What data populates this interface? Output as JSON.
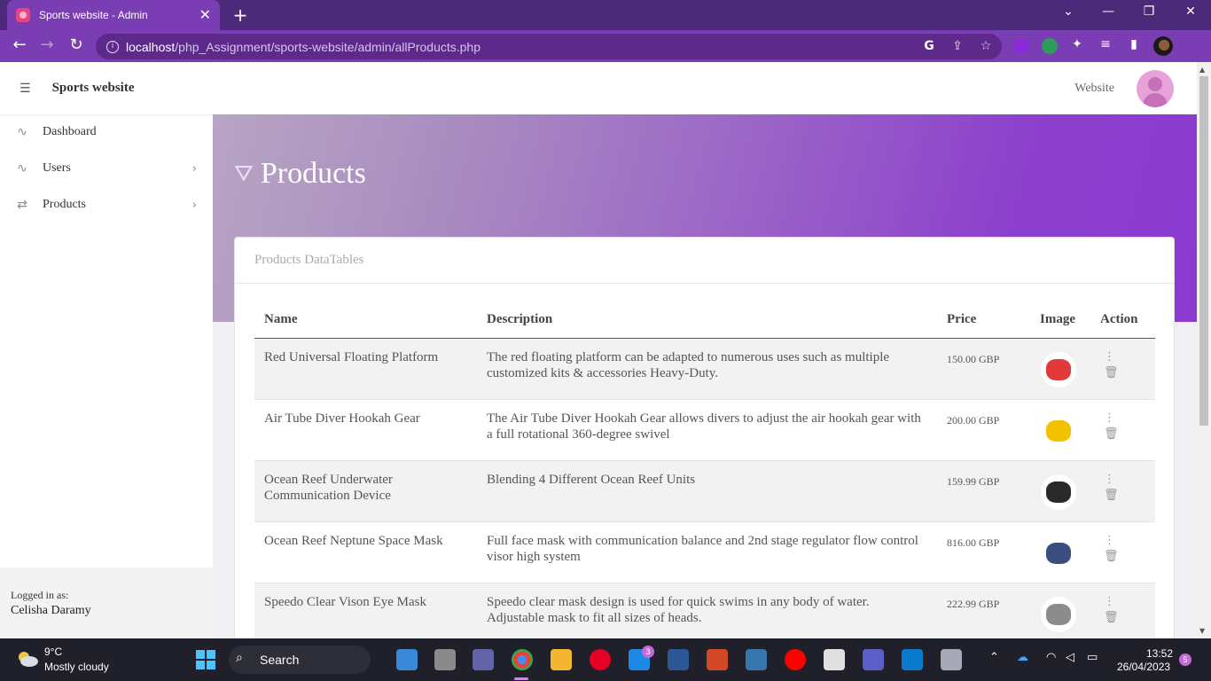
{
  "browser": {
    "tab_title": "Sports website - Admin",
    "url_host": "localhost",
    "url_path": "/php_Assignment/sports-website/admin/allProducts.php",
    "icons": {
      "close": "✕",
      "new_tab": "+",
      "back": "←",
      "forward": "→",
      "reload": "↻",
      "minimize": "—",
      "maximize": "❐",
      "window_close": "✕",
      "chevron": "⌄"
    }
  },
  "sidebar": {
    "brand": "Sports website",
    "items": [
      {
        "label": "Dashboard",
        "icon": "activity-icon"
      },
      {
        "label": "Users",
        "icon": "activity-icon"
      },
      {
        "label": "Products",
        "icon": "repeat-icon"
      }
    ],
    "logged_in_label": "Logged in as:",
    "logged_in_user": "Celisha Daramy"
  },
  "topbar": {
    "website_link": "Website"
  },
  "page": {
    "title": "Products",
    "card_title": "Products DataTables"
  },
  "table": {
    "headers": [
      "Name",
      "Description",
      "Price",
      "Image",
      "Action"
    ],
    "rows": [
      {
        "name": "Red Universal Floating Platform",
        "description": "The red floating platform can be adapted to numerous uses such as multiple customized kits & accessories Heavy-Duty.",
        "price": "150.00 GBP",
        "image_color": "#e23a3a"
      },
      {
        "name": "Air Tube Diver Hookah Gear",
        "description": "The Air Tube Diver Hookah Gear allows divers to adjust the air hookah gear with a full rotational 360-degree swivel",
        "price": "200.00 GBP",
        "image_color": "#f2c200"
      },
      {
        "name": "Ocean Reef Underwater Communication Device",
        "description": "Blending 4 Different Ocean Reef Units",
        "price": "159.99 GBP",
        "image_color": "#2a2a2a"
      },
      {
        "name": "Ocean Reef Neptune Space Mask",
        "description": "Full face mask with communication balance and 2nd stage regulator flow control visor high system",
        "price": "816.00 GBP",
        "image_color": "#3a4f80"
      },
      {
        "name": "Speedo Clear Vison Eye Mask",
        "description": "Speedo clear mask design is used for quick swims in any body of water. Adjustable mask to fit all sizes of heads.",
        "price": "222.99 GBP",
        "image_color": "#8c8c8c"
      }
    ]
  },
  "taskbar": {
    "temperature": "9°C",
    "condition": "Mostly cloudy",
    "search_label": "Search",
    "mail_badge": "3",
    "time": "13:52",
    "date": "26/04/2023",
    "notification_count": "5"
  }
}
